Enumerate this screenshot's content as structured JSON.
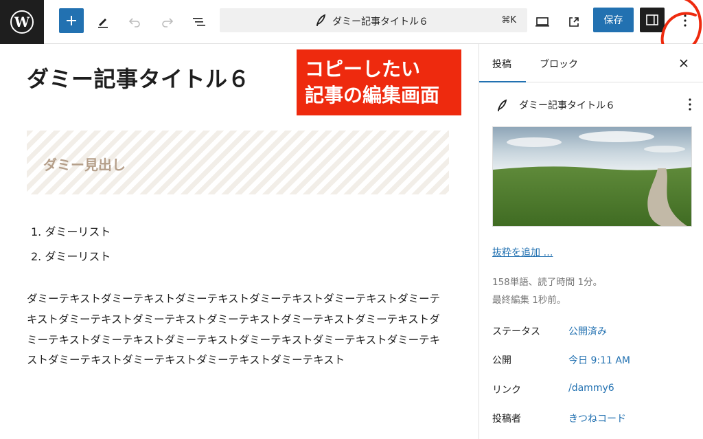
{
  "toolbar": {
    "command_title": "ダミー記事タイトル６",
    "command_shortcut": "⌘K",
    "save_label": "保存"
  },
  "editor": {
    "post_title": "ダミー記事タイトル６",
    "heading": "ダミー見出し",
    "list_items": [
      "1. ダミーリスト",
      "2. ダミーリスト"
    ],
    "paragraph": "ダミーテキストダミーテキストダミーテキストダミーテキストダミーテキストダミーテキストダミーテキストダミーテキストダミーテキストダミーテキストダミーテキストダミーテキストダミーテキストダミーテキストダミーテキストダミーテキストダミーテキストダミーテキストダミーテキストダミーテキストダミーテキスト"
  },
  "callout": {
    "line1": "コピーしたい",
    "line2": "記事の編集画面"
  },
  "sidebar": {
    "tabs": [
      "投稿",
      "ブロック"
    ],
    "post_title": "ダミー記事タイトル６",
    "excerpt_link": "抜粋を追加 …",
    "stats_line1": "158単語、読了時間 1分。",
    "stats_line2": "最終編集 1秒前。",
    "rows": [
      {
        "label": "ステータス",
        "value": "公開済み"
      },
      {
        "label": "公開",
        "value": "今日 9:11 AM"
      },
      {
        "label": "リンク",
        "value": "/dammy6"
      },
      {
        "label": "投稿者",
        "value": "きつねコード"
      }
    ]
  },
  "colors": {
    "accent": "#2271b1",
    "callout": "#ee2a0e",
    "heading_text": "#b59f8a"
  }
}
